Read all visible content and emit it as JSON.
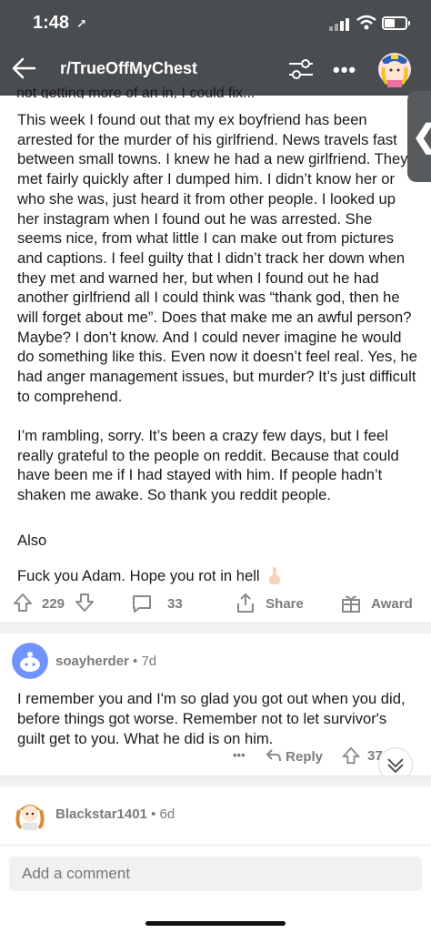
{
  "status_bar": {
    "time": "1:48",
    "location_glyph": "➚"
  },
  "header": {
    "subreddit": "r/TrueOffMyChest",
    "icons": [
      "back-arrow-icon",
      "filter-icon",
      "more-icon",
      "user-avatar"
    ]
  },
  "post": {
    "cut_line": "not getting more of an in, I could fix...",
    "paragraph1": "This week I found out that my ex boyfriend has been arrested for the murder of his girlfriend. News travels fast between small towns. I knew he had a new girlfriend. They met fairly quickly after I dumped him. I didn’t know her or who she was, just heard it from other people. I looked up her instagram when I found out he was arrested. She seems nice, from what little I can make out from pictures and captions. I feel guilty that I didn’t track her down when they met and warned her, but when I found out he had another girlfriend all I could think was “thank god, then he will forget about me”. Does that make me an awful person? Maybe? I don’t know. And I could never imagine he would do something like this. Even now it doesn’t feel real. Yes, he had anger management issues, but murder? It’s just difficult to comprehend.",
    "paragraph2": "I’m rambling, sorry. It’s been a crazy few days, but I feel really grateful to the people on reddit. Because that could have been me if I had stayed with him. If people hadn’t shaken me awake. So thank you reddit people.",
    "paragraph3": "Also",
    "paragraph4": "Fuck you Adam. Hope you rot in hell",
    "upvotes": "229",
    "comments": "33",
    "share_label": "Share",
    "award_label": "Award"
  },
  "comments": [
    {
      "user": "soayherder",
      "age": "7d",
      "text": "I remember you and I'm so glad you got out when you did, before things got worse. Remember not to let survivor's guilt get to you. What he did is on him.",
      "more": "•••",
      "reply_label": "Reply",
      "votes": "37"
    },
    {
      "user": "Blackstar1401",
      "age": "6d"
    }
  ],
  "comment_box": {
    "placeholder": "Add a comment"
  },
  "colors": {
    "header_bg": "#4a4d50",
    "meta_gray": "#7c7c7c",
    "avatar_blue": "#7193ff"
  }
}
